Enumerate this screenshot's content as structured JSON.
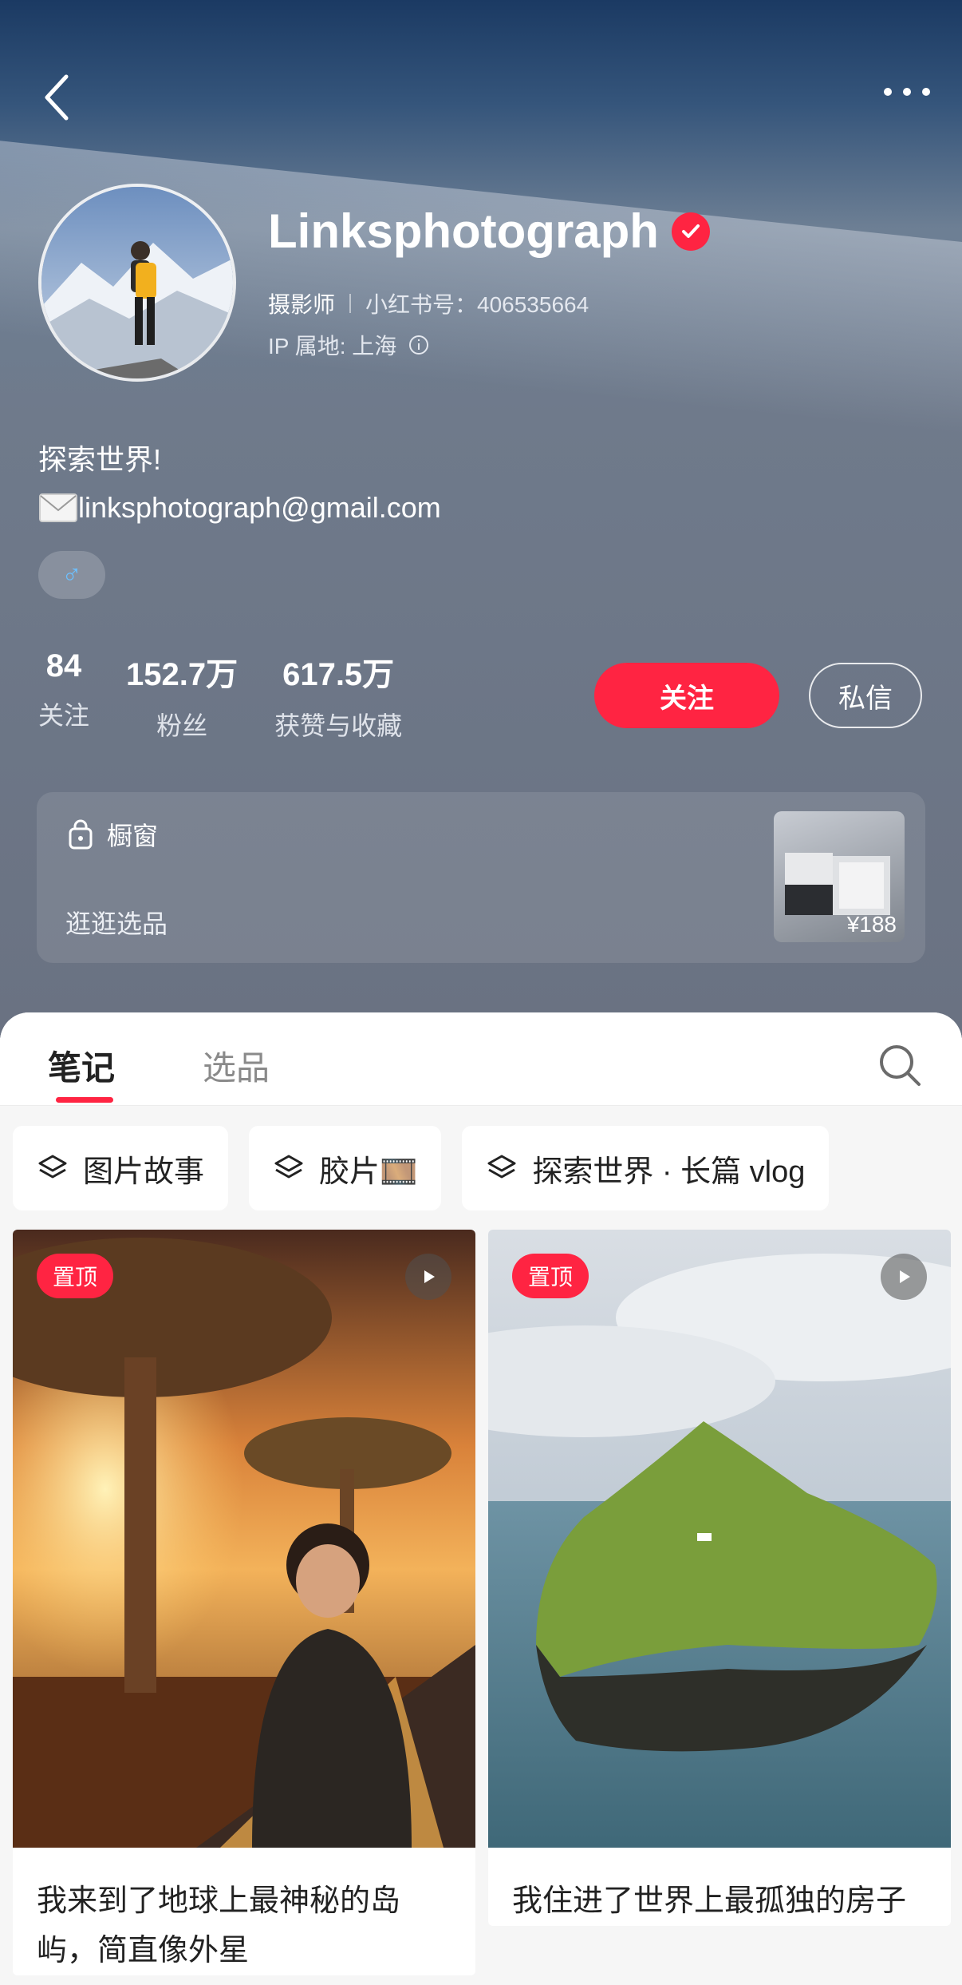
{
  "profile": {
    "name": "Linksphotograph",
    "role": "摄影师",
    "red_id": "小红书号：406535664",
    "ip": "IP 属地: 上海",
    "bio_line1": "探索世界!",
    "bio_line2": "linksphotograph@gmail.com",
    "gender_symbol": "♂"
  },
  "stats": [
    {
      "value": "84",
      "label": "关注"
    },
    {
      "value": "152.7万",
      "label": "粉丝"
    },
    {
      "value": "617.5万",
      "label": "获赞与收藏"
    }
  ],
  "actions": {
    "follow": "关注",
    "message": "私信"
  },
  "shop": {
    "title": "橱窗",
    "subtitle": "逛逛选品",
    "price": "¥188"
  },
  "tabs": {
    "notes": "笔记",
    "products": "选品"
  },
  "collections": [
    "图片故事",
    "胶片🎞️",
    "探索世界 · 长篇 vlog"
  ],
  "notes": [
    {
      "badge": "置顶",
      "title": "我来到了地球上最神秘的岛屿，简直像外星"
    },
    {
      "badge": "置顶",
      "title": "我住进了世界上最孤独的房子"
    }
  ],
  "colors": {
    "accent": "#ff2442",
    "header_top": "#1b3a63",
    "header_body": "#6a7282"
  },
  "icons": [
    "back-arrow-icon",
    "more-icon",
    "verified-icon",
    "info-icon",
    "mail-icon",
    "male-icon",
    "lock-bag-icon",
    "search-icon",
    "layers-icon",
    "play-icon"
  ]
}
